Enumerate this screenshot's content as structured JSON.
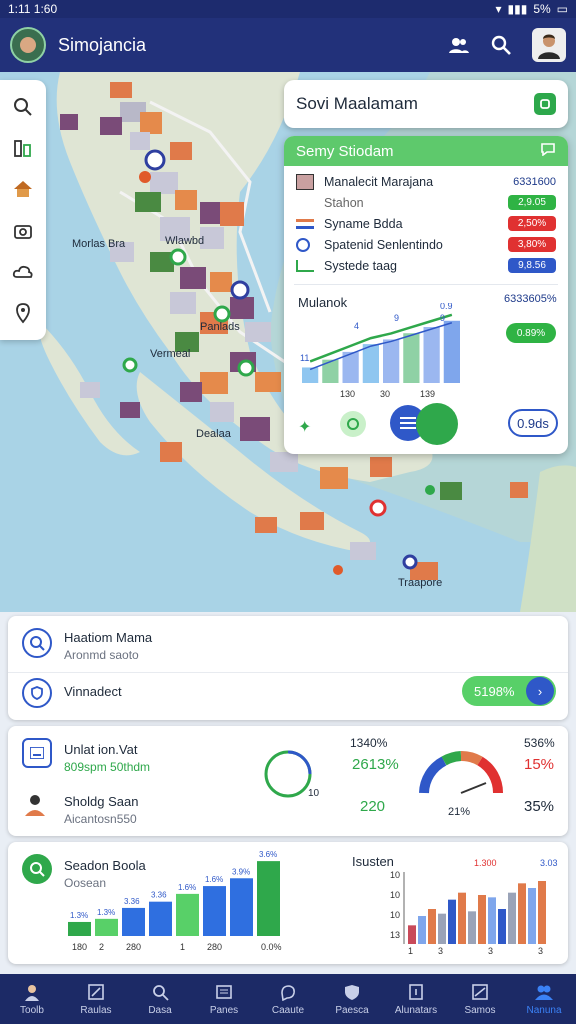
{
  "status": {
    "time": "1:11 1:60",
    "battery": "5%"
  },
  "app": {
    "title": "Simojancia"
  },
  "search": {
    "value": "Sovi Maalamam"
  },
  "panel": {
    "title": "Semy Stiodam",
    "rows": [
      {
        "label": "Manalecit Marajana",
        "value": "6331600",
        "color": "#1e3a8a"
      },
      {
        "label": "Stahon",
        "value": "2,9.05",
        "color": "#2fb344"
      },
      {
        "label": "Syname Bdda",
        "value": "2,50%",
        "color": "#e03131"
      },
      {
        "label": "Spatenid Senlentindo",
        "value": "3,80%",
        "color": "#e03131"
      },
      {
        "label": "Systede taag",
        "value": "9,8.56",
        "color": "#2f58c8"
      }
    ],
    "chart_title": "Mulanok",
    "chart_value": "6333605%",
    "chart_badge": "0.89%",
    "chart_top_labels": [
      "11",
      "4",
      "9",
      "9",
      "0.9"
    ],
    "chart_x_labels": [
      "130",
      "30",
      "139"
    ],
    "chart_bottom_badge": "0.9ds"
  },
  "chart_data": [
    {
      "type": "bar",
      "categories": [
        "",
        "",
        "",
        "",
        "",
        "",
        "",
        ""
      ],
      "series": [
        {
          "values": [
            10,
            15,
            20,
            25,
            28,
            32,
            36,
            40
          ]
        }
      ],
      "ylim": [
        0,
        45
      ]
    },
    {
      "type": "bar",
      "categories": [
        "",
        "2",
        "",
        "",
        "1",
        "",
        "",
        ""
      ],
      "x_tick_labels": [
        "180",
        "2",
        "280",
        "",
        "1",
        "280",
        "",
        "0.0%"
      ],
      "series": [
        {
          "values": [
            9,
            11,
            18,
            22,
            27,
            32,
            37,
            48
          ]
        }
      ],
      "value_labels": [
        "1.3%",
        "1.3%",
        "3.36",
        "3.36",
        "1.6%",
        "1.6%",
        "3.9%",
        "3.6%"
      ],
      "ylim": [
        0,
        50
      ]
    },
    {
      "type": "bar",
      "categories": [
        "",
        "",
        "",
        "",
        "",
        "",
        "",
        "",
        "",
        "",
        "",
        "",
        "",
        ""
      ],
      "x_tick_labels": [
        "1",
        "",
        "",
        "3",
        "",
        "",
        "",
        "",
        "3",
        "",
        "",
        "",
        "",
        "3"
      ],
      "series": [
        {
          "values": [
            16,
            24,
            30,
            26,
            38,
            44,
            28,
            42,
            40,
            30,
            44,
            52,
            48,
            54
          ]
        }
      ],
      "y_tick_labels": [
        "10",
        "10",
        "10",
        "13"
      ],
      "top_labels": [
        "1.300",
        "3.03"
      ],
      "ylim": [
        0,
        60
      ]
    }
  ],
  "card1": {
    "title": "Haatiom Mama",
    "subtitle": "Aronmd saoto",
    "row2": "Vinnadect",
    "badge": "5198%"
  },
  "card2": {
    "title": "Unlat ion.Vat",
    "subtitle": "809spm 50thdm",
    "row2_title": "Sholdg Saan",
    "row2_subtitle": "Aicantosn550",
    "ring_label": "10",
    "stat1": "1340%",
    "stat1b": "2613%",
    "stat2": "220",
    "gauge_label": "21%",
    "right1": "536%",
    "right2": "15%",
    "right3": "35%"
  },
  "card3": {
    "title": "Seadon Boola",
    "subtitle": "Oosean",
    "right_title": "Isusten"
  },
  "nav": [
    {
      "label": "Toolb",
      "icon": "person-icon"
    },
    {
      "label": "Raulas",
      "icon": "edit-icon"
    },
    {
      "label": "Dasa",
      "icon": "search-icon"
    },
    {
      "label": "Panes",
      "icon": "card-icon"
    },
    {
      "label": "Caaute",
      "icon": "bubble-icon"
    },
    {
      "label": "Paesca",
      "icon": "shield-icon"
    },
    {
      "label": "Alunatars",
      "icon": "frame-icon"
    },
    {
      "label": "Samos",
      "icon": "book-icon"
    },
    {
      "label": "Nanuna",
      "icon": "group-icon",
      "active": true
    }
  ],
  "map_labels": [
    "Morlas Bra",
    "Wlawbd",
    "Vermeal",
    "Panlads",
    "Dealaa",
    "Traapore"
  ],
  "colors": {
    "appbar": "#22317a",
    "green": "#2da84b",
    "blue": "#2f6fe0",
    "red": "#e03131"
  }
}
